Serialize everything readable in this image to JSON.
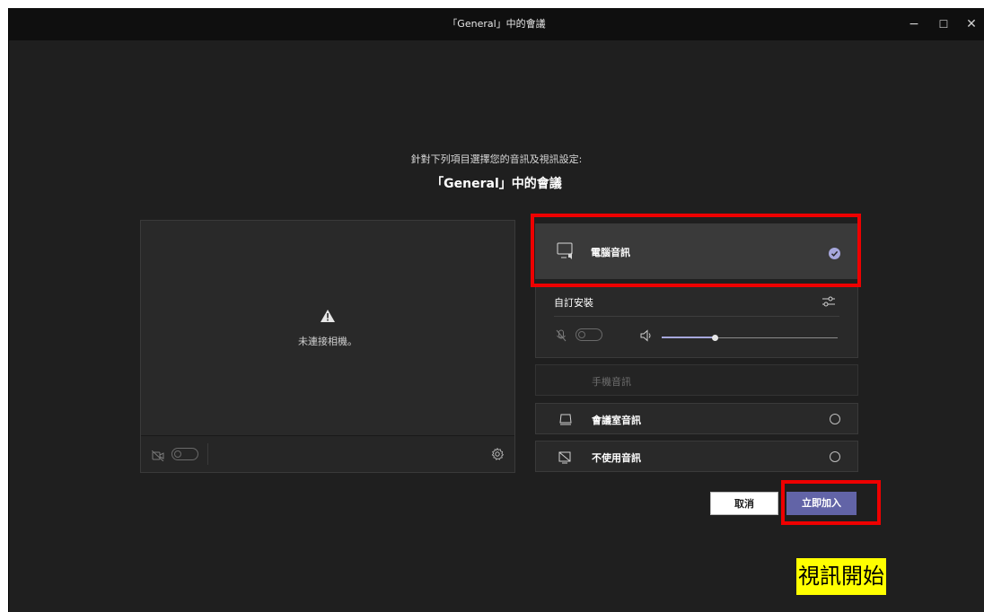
{
  "window": {
    "title": "「General」中的會議",
    "controls": {
      "minimize": "−",
      "maximize": "☐",
      "close": "✕"
    }
  },
  "prejoin": {
    "subtitle": "針對下列項目選擇您的音訊及視訊設定:",
    "meeting_title": "「General」中的會議"
  },
  "video": {
    "status_text": "未連接相機。",
    "camera_toggle_on": false
  },
  "audio_options": {
    "computer_audio": {
      "label": "電腦音訊",
      "selected": true
    },
    "custom_setup": {
      "label": "自訂安裝",
      "mic_toggle_on": false,
      "volume_level": 0.3
    },
    "phone_audio": {
      "label": "手機音訊"
    },
    "room_audio": {
      "label": "會議室音訊"
    },
    "no_audio": {
      "label": "不使用音訊"
    }
  },
  "actions": {
    "cancel_label": "取消",
    "join_label": "立即加入"
  },
  "annotation": {
    "text": "視訊開始"
  },
  "colors": {
    "accent": "#6264a7",
    "highlight_box": "#ee0000",
    "annotation_bg": "#ffff00"
  }
}
